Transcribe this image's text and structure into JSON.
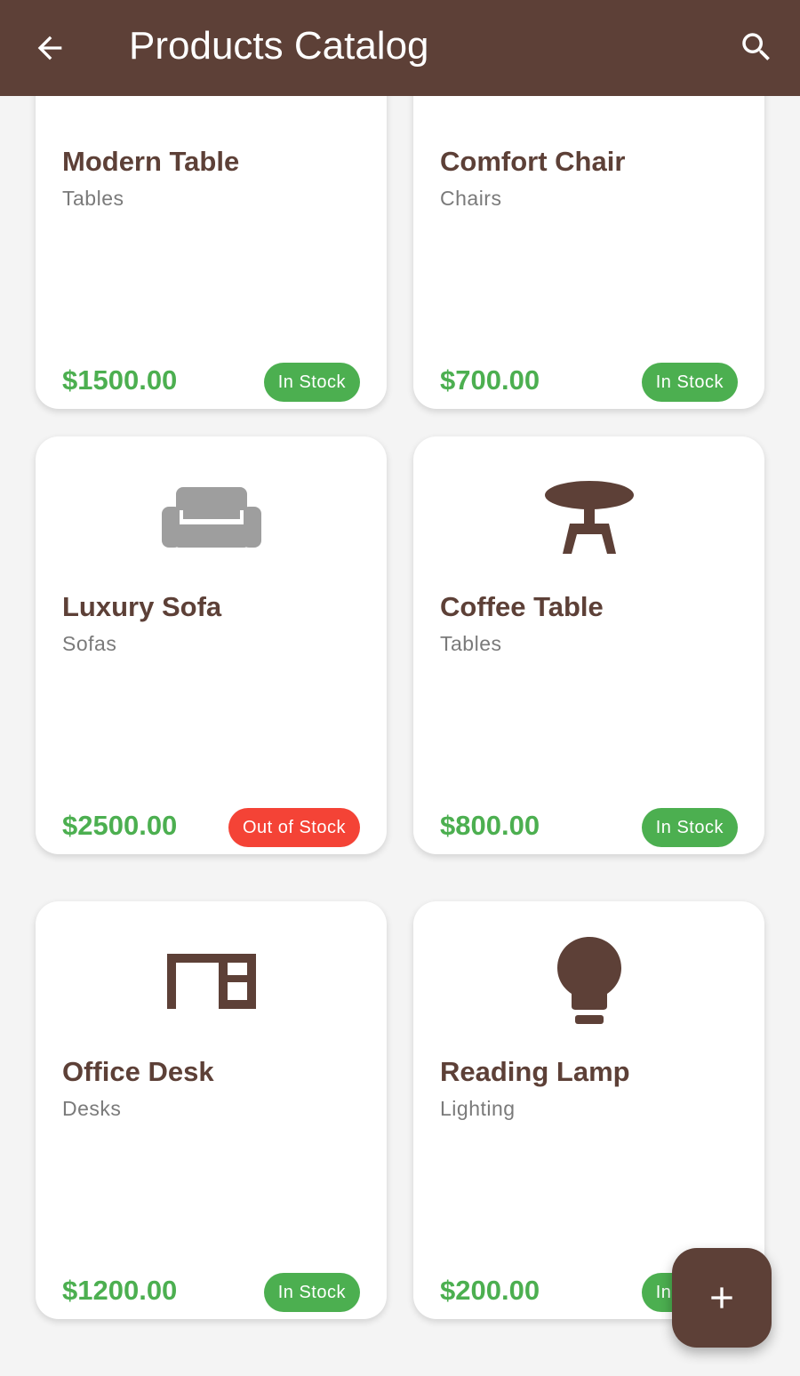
{
  "app_bar": {
    "title": "Products Catalog",
    "back_icon": "arrow-back-icon",
    "search_icon": "search-icon",
    "background": "#5d4037"
  },
  "products": [
    {
      "name": "Modern Table",
      "category": "Tables",
      "price": "$1500.00",
      "status": "In Stock",
      "in_stock": true,
      "icon": "table-icon"
    },
    {
      "name": "Comfort Chair",
      "category": "Chairs",
      "price": "$700.00",
      "status": "In Stock",
      "in_stock": true,
      "icon": "chair-icon"
    },
    {
      "name": "Luxury Sofa",
      "category": "Sofas",
      "price": "$2500.00",
      "status": "Out of Stock",
      "in_stock": false,
      "icon": "sofa-icon"
    },
    {
      "name": "Coffee Table",
      "category": "Tables",
      "price": "$800.00",
      "status": "In Stock",
      "in_stock": true,
      "icon": "round-table-icon"
    },
    {
      "name": "Office Desk",
      "category": "Desks",
      "price": "$1200.00",
      "status": "In Stock",
      "in_stock": true,
      "icon": "desk-icon"
    },
    {
      "name": "Reading Lamp",
      "category": "Lighting",
      "price": "$200.00",
      "status": "In Stock",
      "in_stock": true,
      "icon": "lightbulb-icon"
    }
  ],
  "fab": {
    "icon": "add-icon"
  },
  "colors": {
    "primary": "#5d4037",
    "price": "#4caf50",
    "in_stock": "#4caf50",
    "out_of_stock": "#f44336",
    "muted_icon": "#9e9e9e"
  }
}
